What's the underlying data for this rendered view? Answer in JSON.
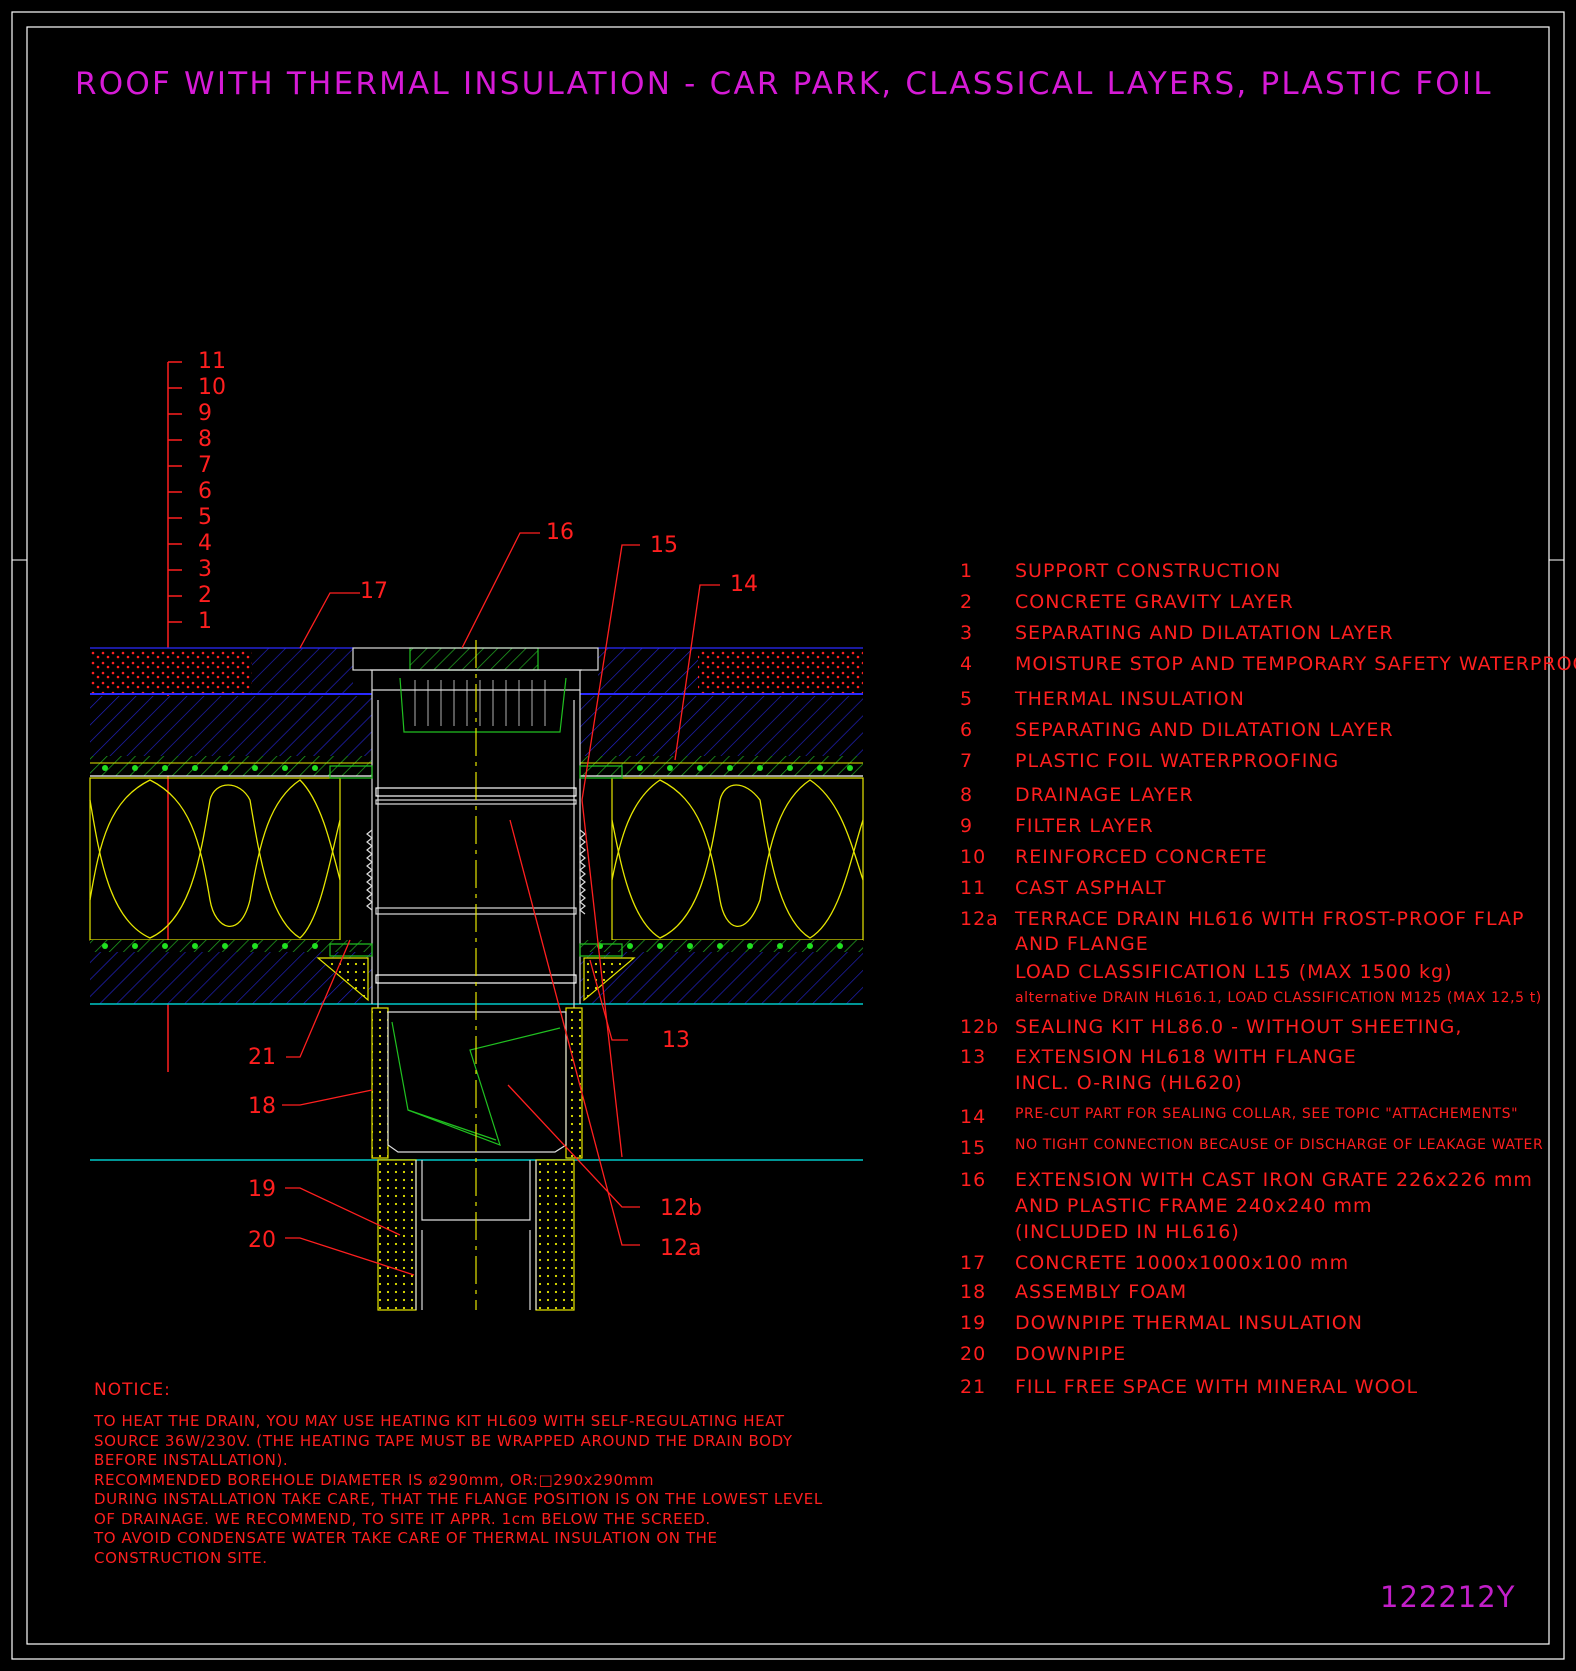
{
  "title": "ROOF WITH THERMAL INSULATION - CAR PARK, CLASSICAL LAYERS, PLASTIC FOIL",
  "drawing_code": "122212Y",
  "layer_scale": [
    "11",
    "10",
    "9",
    "8",
    "7",
    "6",
    "5",
    "4",
    "3",
    "2",
    "1"
  ],
  "callouts": {
    "c16": "16",
    "c15": "15",
    "c17": "17",
    "c14": "14",
    "c13": "13",
    "c21": "21",
    "c18": "18",
    "c19": "19",
    "c20": "20",
    "c12b": "12b",
    "c12a": "12a"
  },
  "legend": [
    {
      "num": "1",
      "lines": [
        "SUPPORT CONSTRUCTION"
      ]
    },
    {
      "num": "2",
      "lines": [
        "CONCRETE GRAVITY LAYER"
      ]
    },
    {
      "num": "3",
      "lines": [
        "SEPARATING AND DILATATION LAYER"
      ]
    },
    {
      "num": "4",
      "lines": [
        "MOISTURE STOP AND TEMPORARY SAFETY WATERPROOFING"
      ]
    },
    {
      "num": "5",
      "lines": [
        "THERMAL INSULATION"
      ]
    },
    {
      "num": "6",
      "lines": [
        "SEPARATING AND DILATATION LAYER"
      ]
    },
    {
      "num": "7",
      "lines": [
        "PLASTIC FOIL WATERPROOFING"
      ]
    },
    {
      "num": "8",
      "lines": [
        "DRAINAGE LAYER"
      ]
    },
    {
      "num": "9",
      "lines": [
        "FILTER LAYER"
      ]
    },
    {
      "num": "10",
      "lines": [
        "REINFORCED CONCRETE"
      ]
    },
    {
      "num": "11",
      "lines": [
        "CAST ASPHALT"
      ]
    },
    {
      "num": "12a",
      "lines": [
        "TERRACE DRAIN HL616 WITH FROST-PROOF FLAP",
        "AND FLANGE",
        "LOAD CLASSIFICATION L15 (MAX 1500 kg)"
      ],
      "note": "alternative DRAIN HL616.1, LOAD CLASSIFICATION M125 (MAX 12,5 t)"
    },
    {
      "num": "12b",
      "lines": [
        "SEALING KIT HL86.0 - WITHOUT SHEETING,"
      ]
    },
    {
      "num": "13",
      "lines": [
        "EXTENSION HL618 WITH FLANGE",
        "INCL. O-RING (HL620)"
      ]
    },
    {
      "num": "14",
      "lines": [
        "PRE-CUT PART FOR SEALING COLLAR, SEE TOPIC \"ATTACHEMENTS\""
      ],
      "small": true
    },
    {
      "num": "15",
      "lines": [
        "NO TIGHT CONNECTION BECAUSE OF DISCHARGE OF LEAKAGE WATER"
      ],
      "small": true
    },
    {
      "num": "16",
      "lines": [
        "EXTENSION WITH CAST IRON GRATE 226x226 mm",
        "AND PLASTIC FRAME 240x240 mm",
        "(INCLUDED IN HL616)"
      ]
    },
    {
      "num": "17",
      "lines": [
        "CONCRETE 1000x1000x100 mm"
      ]
    },
    {
      "num": "18",
      "lines": [
        "ASSEMBLY FOAM"
      ]
    },
    {
      "num": "19",
      "lines": [
        "DOWNPIPE THERMAL INSULATION"
      ]
    },
    {
      "num": "20",
      "lines": [
        "DOWNPIPE"
      ]
    },
    {
      "num": "21",
      "lines": [
        "FILL FREE SPACE WITH MINERAL WOOL"
      ]
    }
  ],
  "notice": {
    "heading": "NOTICE:",
    "lines": [
      "TO HEAT THE DRAIN, YOU MAY USE HEATING KIT HL609 WITH SELF-REGULATING HEAT",
      "SOURCE 36W/230V. (THE HEATING TAPE MUST BE WRAPPED AROUND THE DRAIN BODY",
      "BEFORE INSTALLATION).",
      "RECOMMENDED BOREHOLE DIAMETER IS ø290mm, OR:□290x290mm",
      "DURING INSTALLATION TAKE CARE, THAT THE FLANGE POSITION IS ON THE LOWEST LEVEL",
      "OF DRAINAGE. WE RECOMMEND, TO SITE IT APPR. 1cm BELOW THE SCREED.",
      "TO AVOID CONDENSATE WATER TAKE CARE OF THERMAL INSULATION ON THE",
      "CONSTRUCTION SITE."
    ]
  },
  "colors": {
    "background": "#000000",
    "frame": "#ffffff",
    "title": "#d61bd6",
    "annotation": "#ff1f1f",
    "concrete_hatch": "#2222cc",
    "insulation": "#e6e600",
    "foil": "#20d020",
    "base_line": "#00c8c8",
    "drain_body": "#dddddd"
  }
}
